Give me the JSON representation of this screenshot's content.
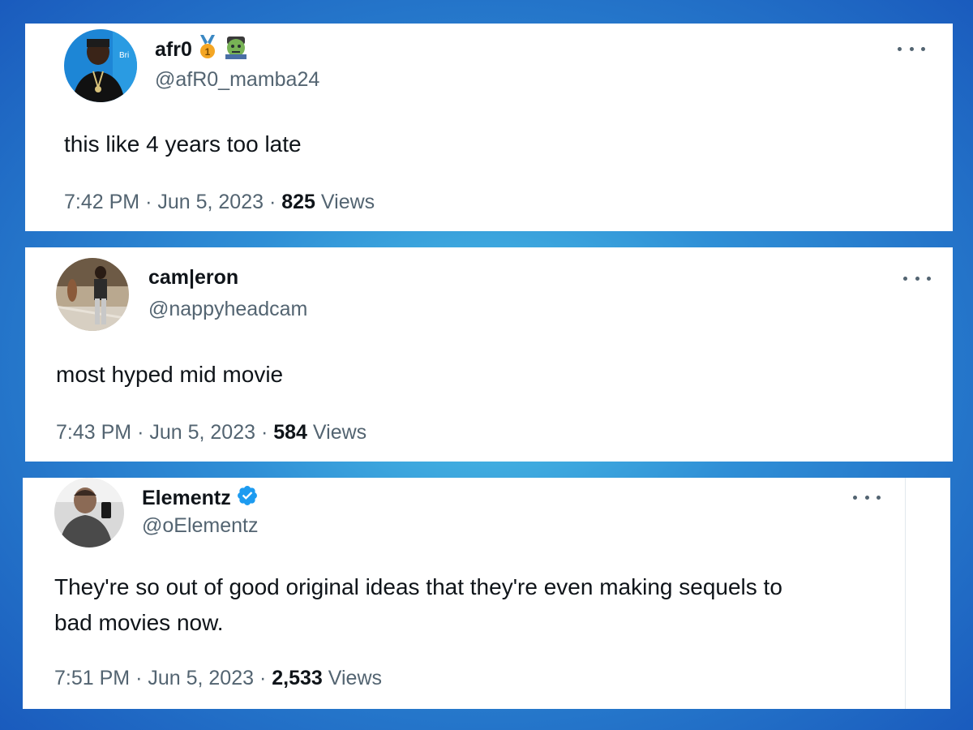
{
  "tweets": [
    {
      "display_name": "afr0",
      "name_emoji": [
        "medal-icon",
        "zombie-icon"
      ],
      "handle": "@afR0_mamba24",
      "text": "this like 4 years too late",
      "time": "7:42 PM",
      "date": "Jun 5, 2023",
      "views_count": "825",
      "views_label": "Views"
    },
    {
      "display_name": "cam|eron",
      "handle": "@nappyheadcam",
      "text": "most hyped mid movie",
      "time": "7:43 PM",
      "date": "Jun 5, 2023",
      "views_count": "584",
      "views_label": "Views"
    },
    {
      "display_name": "Elementz",
      "verified": true,
      "handle": "@oElementz",
      "text_line1": "They're so out of good original ideas that they're even making sequels to",
      "text_line2": "bad movies now.",
      "time": "7:51 PM",
      "date": "Jun 5, 2023",
      "views_count": "2,533",
      "views_label": "Views"
    }
  ],
  "separator": "·",
  "colors": {
    "text_primary": "#0f1419",
    "text_secondary": "#536471",
    "verified_blue": "#1d9bf0",
    "background_outer": "#1a5bbd",
    "background_glow": "#4fc6e8"
  }
}
